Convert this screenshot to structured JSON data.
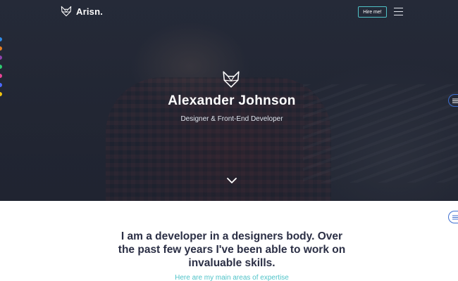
{
  "brand": {
    "name": "Arisn."
  },
  "nav": {
    "hire_label": "Hire me!"
  },
  "hero": {
    "name": "Alexander Johnson",
    "role": "Designer & Front-End Developer"
  },
  "intro": {
    "headline": "I am a developer in a designers body. Over the past few years I've been able to work on invaluable skills.",
    "expertise": "Here are my main areas of expertise"
  },
  "color_swatches": [
    "#2f8be6",
    "#e67e22",
    "#8e44ad",
    "#2ecc71",
    "#e84393",
    "#4a69ff",
    "#f1c40f"
  ],
  "colors": {
    "accent": "#4fc3c8",
    "toggle_border": "#3f6fd0",
    "heading": "#2b2f45"
  },
  "icons": {
    "brand": "fox-head-icon",
    "menu": "hamburger-menu-icon",
    "scroll": "chevron-down-icon",
    "settings": "sliders-icon"
  }
}
